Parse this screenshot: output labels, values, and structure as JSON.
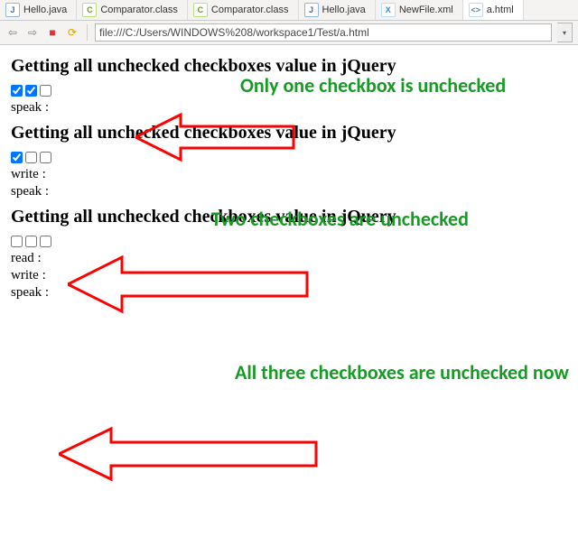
{
  "tabs": [
    {
      "icon": "J",
      "cls": "ic-j",
      "label": "Hello.java"
    },
    {
      "icon": "C",
      "cls": "ic-c",
      "label": "Comparator.class"
    },
    {
      "icon": "C",
      "cls": "ic-c",
      "label": "Comparator.class"
    },
    {
      "icon": "J",
      "cls": "ic-j",
      "label": "Hello.java"
    },
    {
      "icon": "X",
      "cls": "ic-x",
      "label": "NewFile.xml"
    },
    {
      "icon": "<>",
      "cls": "ic-h",
      "label": "a.html"
    }
  ],
  "active_tab": 5,
  "toolbar": {
    "back_glyph": "⇦",
    "fwd_glyph": "⇨",
    "stop_glyph": "■",
    "refresh_glyph": "⟳",
    "stop_color": "#d33",
    "refresh_color": "#d9a300",
    "address": "file:///C:/Users/WINDOWS%208/workspace1/Test/a.html",
    "dd_glyph": "▾"
  },
  "sections": [
    {
      "heading": "Getting all unchecked checkboxes value in jQuery",
      "checks": [
        true,
        true,
        false
      ],
      "out": [
        "speak :"
      ]
    },
    {
      "heading": "Getting all unchecked checkboxes value in jQuery",
      "checks": [
        true,
        false,
        false
      ],
      "out": [
        "write :",
        "speak :"
      ]
    },
    {
      "heading": "Getting all unchecked checkboxes value in jQuery",
      "checks": [
        false,
        false,
        false
      ],
      "out": [
        "read :",
        "write :",
        "speak :"
      ]
    }
  ],
  "annotations": {
    "a1": "Only one checkbox is unchecked",
    "a2": "Two checkboxes are unchecked",
    "a3": "All three checkboxes are unchecked now"
  }
}
